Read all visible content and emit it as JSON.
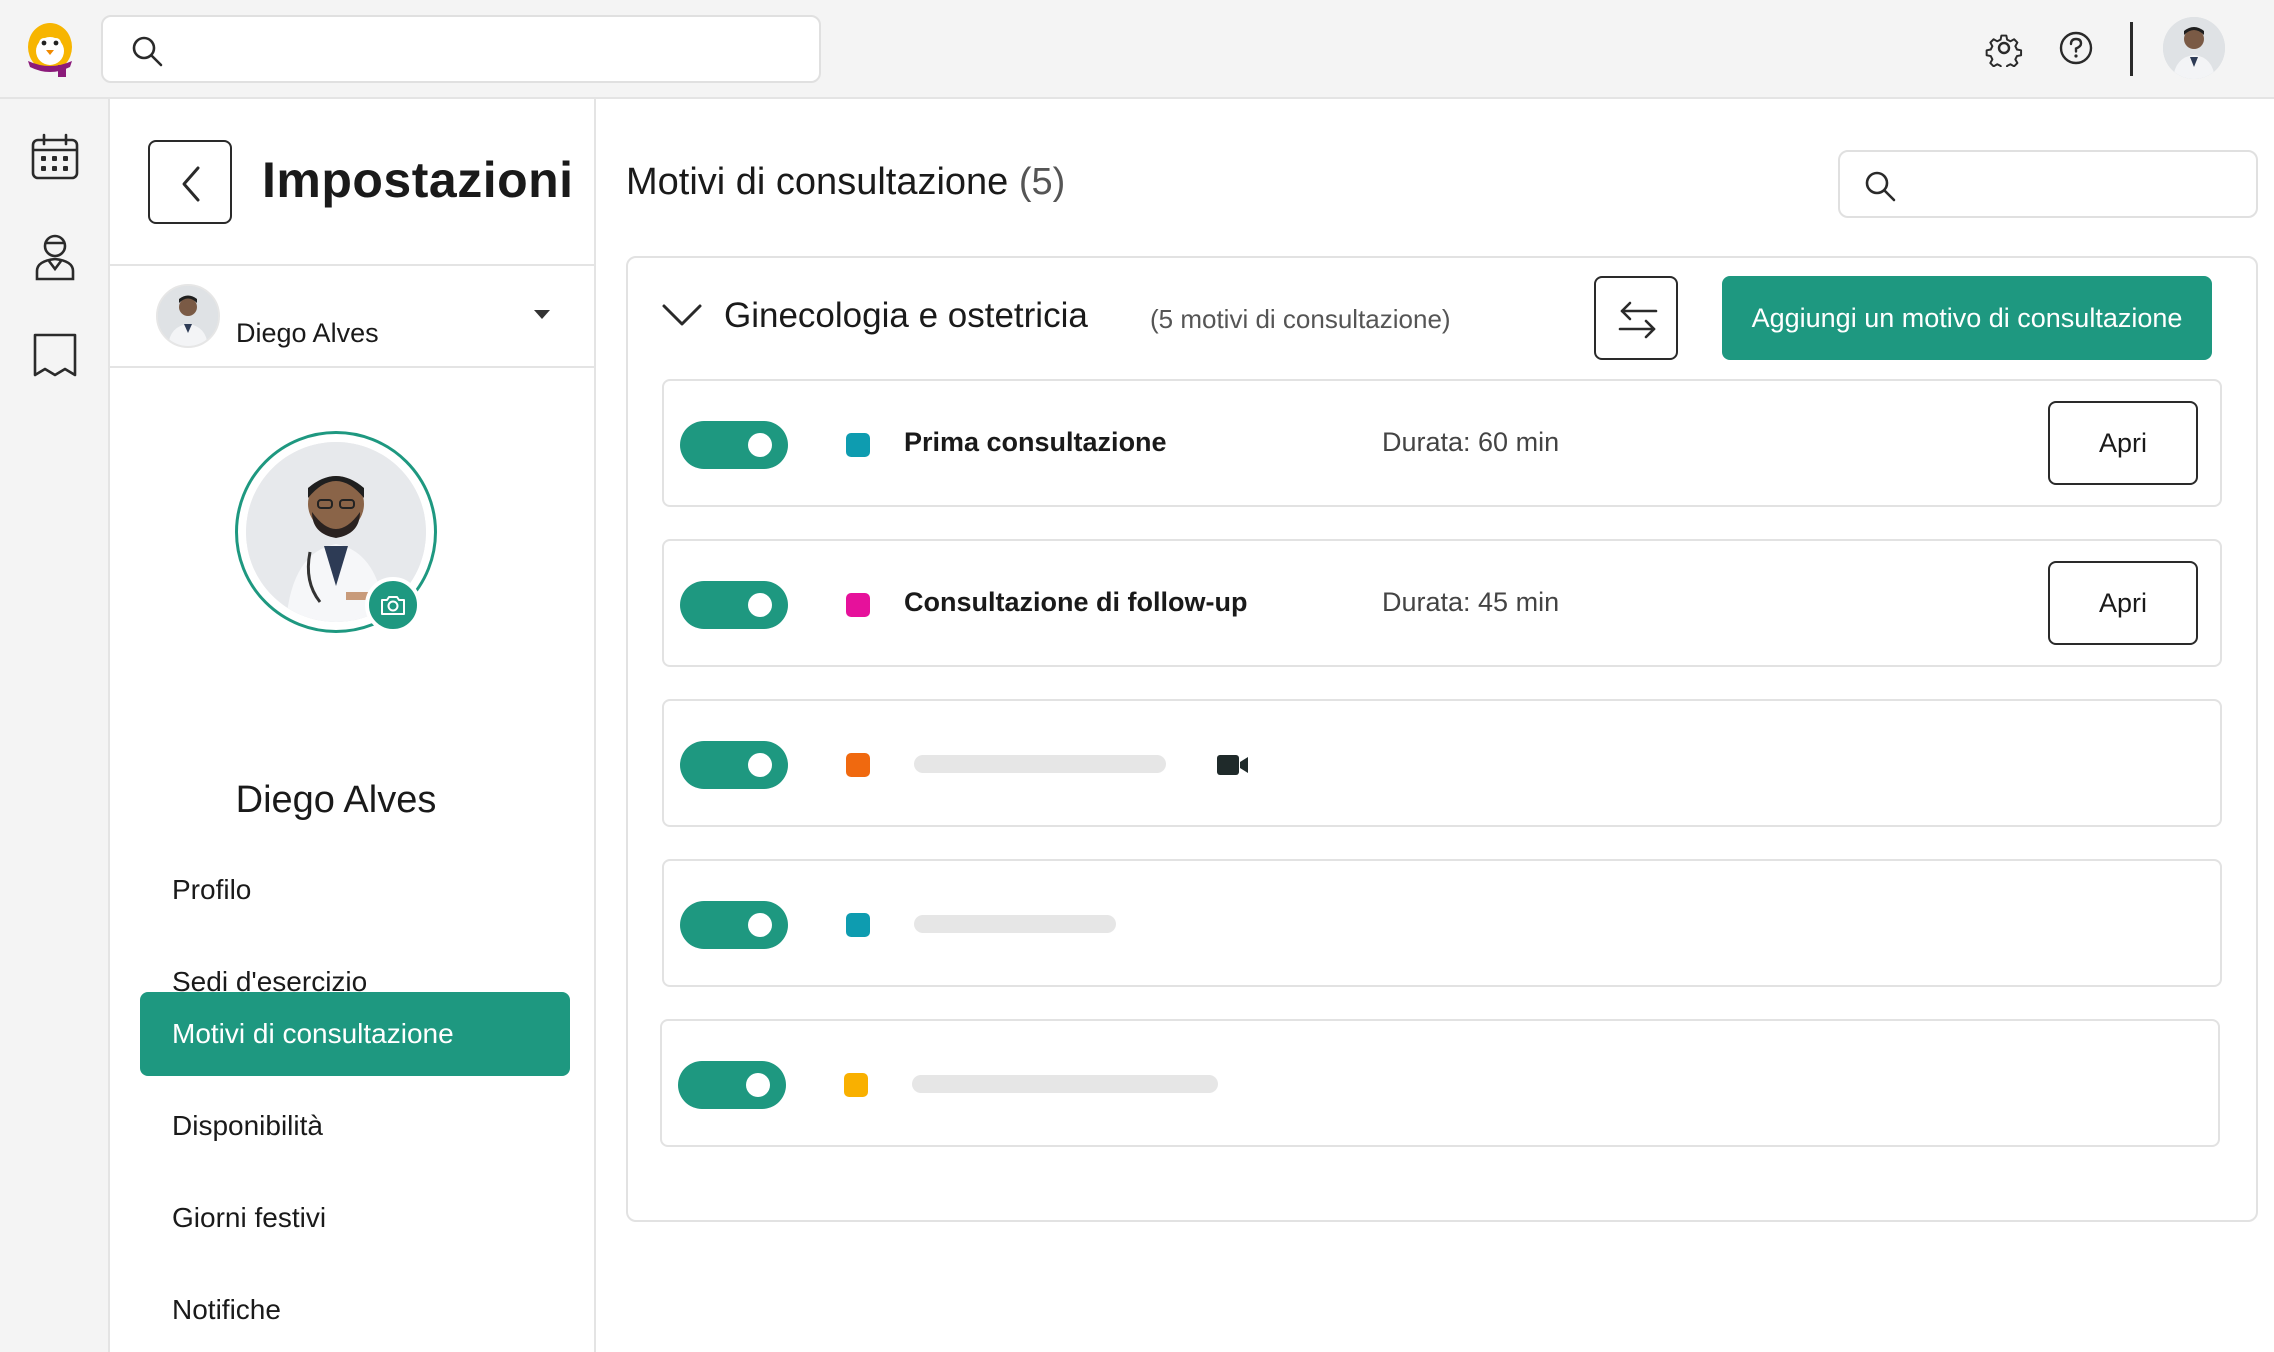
{
  "top_bar": {
    "search_placeholder": ""
  },
  "rail": {
    "items": [
      "calendar-icon",
      "doctor-icon",
      "book-icon"
    ]
  },
  "settings": {
    "title": "Impostazioni",
    "selected_user": "Diego Alves",
    "profile_name": "Diego Alves",
    "menu": [
      {
        "label": "Profilo",
        "active": false
      },
      {
        "label": "Sedi d'esercizio",
        "active": false
      },
      {
        "label": "Motivi di consultazione",
        "active": true
      },
      {
        "label": "Disponibilità",
        "active": false
      },
      {
        "label": "Giorni festivi",
        "active": false
      },
      {
        "label": "Notifiche",
        "active": false
      }
    ]
  },
  "main": {
    "title": "Motivi di consultazione",
    "title_count": "(5)",
    "search_placeholder": "",
    "group": {
      "name": "Ginecologia e ostetricia",
      "count_label": "(5 motivi di consultazione)",
      "add_button": "Aggiungi un motivo di consultazione",
      "rows": [
        {
          "label": "Prima consultazione",
          "duration": "Durata: 60 min",
          "color": "#0e9cb0",
          "enabled": true,
          "open_label": "Apri"
        },
        {
          "label": "Consultazione di follow-up",
          "duration": "Durata: 45 min",
          "color": "#e6119b",
          "enabled": true,
          "open_label": "Apri"
        },
        {
          "label": "",
          "duration": "",
          "color": "#f0690f",
          "enabled": true,
          "video": true
        },
        {
          "label": "",
          "duration": "",
          "color": "#0e9cb0",
          "enabled": true
        },
        {
          "label": "",
          "duration": "",
          "color": "#f9b000",
          "enabled": true
        }
      ]
    }
  },
  "colors": {
    "accent": "#1e9880"
  }
}
